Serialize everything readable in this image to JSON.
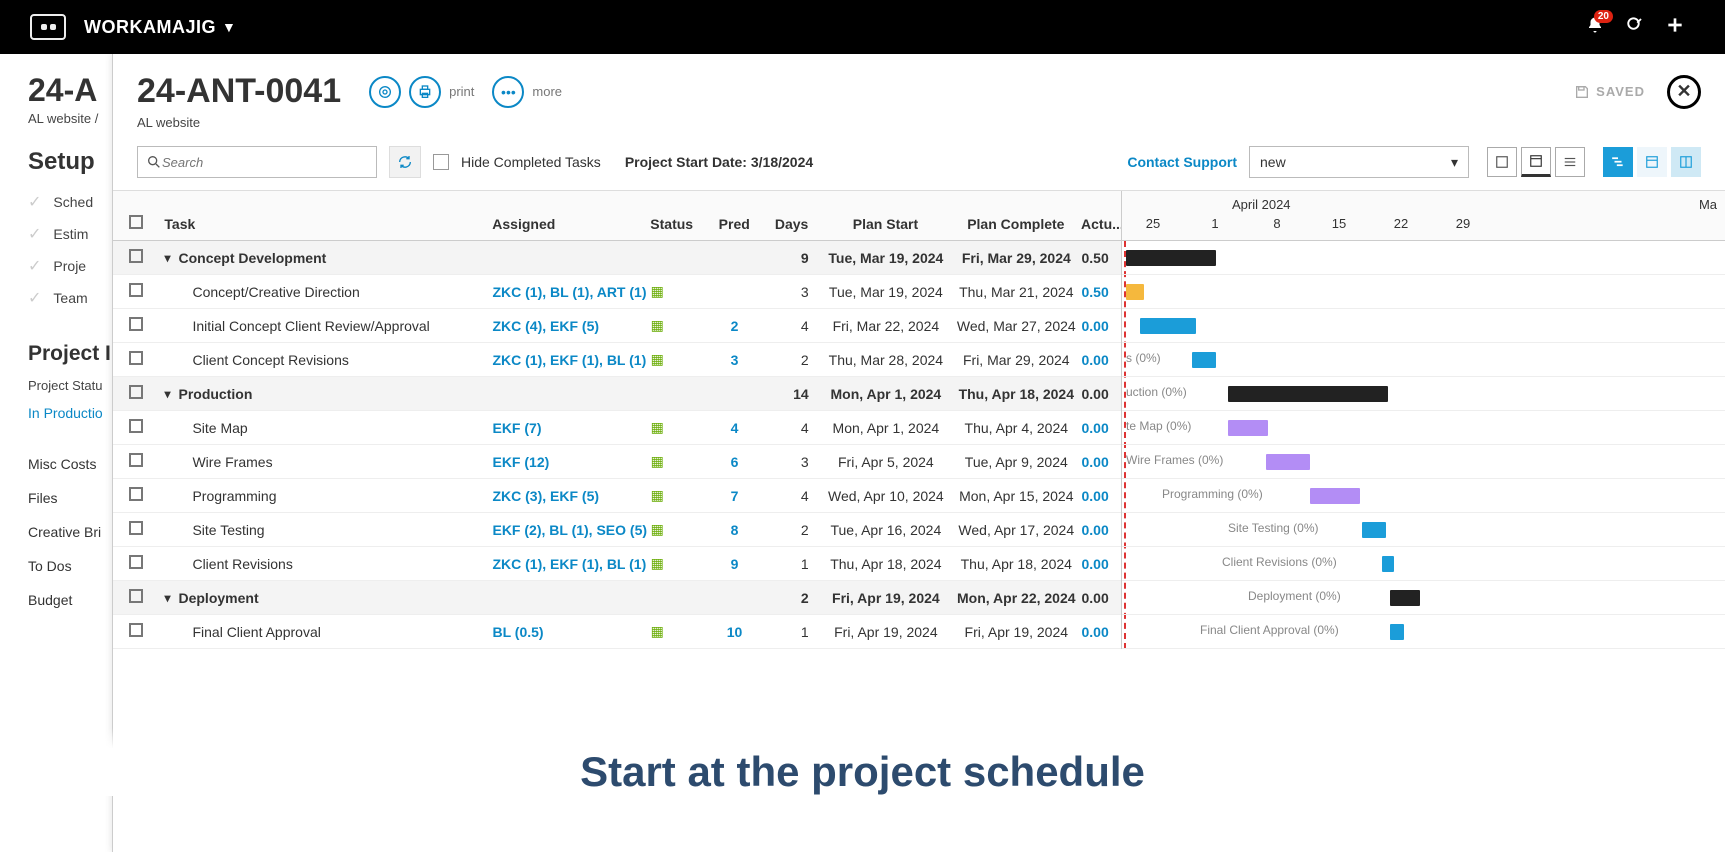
{
  "brand": "WORKAMAJIG",
  "notif_count": "20",
  "left": {
    "title": "24-A",
    "sub": "AL website /",
    "setup": "Setup",
    "setup_items": [
      "Sched",
      "Estim",
      "Proje",
      "Team"
    ],
    "proj_h": "Project I",
    "status_lbl": "Project Statu",
    "status_val": "In Productio",
    "links": [
      "Misc Costs",
      "Files",
      "Creative Bri",
      "To Dos",
      "Budget"
    ]
  },
  "header": {
    "title": "24-ANT-0041",
    "sub": "AL website",
    "print": "print",
    "more": "more",
    "saved": "SAVED"
  },
  "toolbar": {
    "search_ph": "Search",
    "hide": "Hide Completed Tasks",
    "psd_label": "Project Start Date: ",
    "psd_val": "3/18/2024",
    "support": "Contact Support",
    "dd": "new"
  },
  "cols": {
    "task": "Task",
    "assigned": "Assigned",
    "status": "Status",
    "pred": "Pred",
    "days": "Days",
    "ps": "Plan Start",
    "pc": "Plan Complete",
    "act": "Actu..."
  },
  "gantt": {
    "month": "April 2024",
    "month2": "Ma",
    "days": [
      "25",
      "1",
      "8",
      "15",
      "22",
      "29"
    ],
    "labels": {
      "r3": "s (0%)",
      "r4": "uction (0%)",
      "r5": "te Map (0%)",
      "r6": "Wire Frames (0%)",
      "r7": "Programming (0%)",
      "r8": "Site Testing (0%)",
      "r9": "Client Revisions (0%)",
      "r10": "Deployment (0%)",
      "r11": "Final Client Approval (0%)"
    }
  },
  "rows": [
    {
      "g": 1,
      "task": "Concept Development",
      "ass": "",
      "pred": "",
      "days": "9",
      "ps": "Tue, Mar 19, 2024",
      "pc": "Fri, Mar 29, 2024",
      "act": "0.50",
      "aL": 0
    },
    {
      "g": 0,
      "task": "Concept/Creative Direction",
      "ass": "ZKC (1), BL (1), ART (1)",
      "pred": "",
      "cal": 1,
      "days": "3",
      "ps": "Tue, Mar 19, 2024",
      "pc": "Thu, Mar 21, 2024",
      "act": "0.50",
      "aL": 1
    },
    {
      "g": 0,
      "task": "Initial Concept Client Review/Approval",
      "ass": "ZKC (4), EKF (5)",
      "pred": "2",
      "cal": 1,
      "days": "4",
      "ps": "Fri, Mar 22, 2024",
      "pc": "Wed, Mar 27, 2024",
      "act": "0.00",
      "aL": 1
    },
    {
      "g": 0,
      "task": "Client Concept Revisions",
      "ass": "ZKC (1), EKF (1), BL (1)",
      "pred": "3",
      "cal": 1,
      "days": "2",
      "ps": "Thu, Mar 28, 2024",
      "pc": "Fri, Mar 29, 2024",
      "act": "0.00",
      "aL": 1
    },
    {
      "g": 1,
      "task": "Production",
      "ass": "",
      "pred": "",
      "days": "14",
      "ps": "Mon, Apr 1, 2024",
      "pc": "Thu, Apr 18, 2024",
      "act": "0.00",
      "aL": 0
    },
    {
      "g": 0,
      "task": "Site Map",
      "ass": "EKF (7)",
      "pred": "4",
      "cal": 1,
      "days": "4",
      "ps": "Mon, Apr 1, 2024",
      "pc": "Thu, Apr 4, 2024",
      "act": "0.00",
      "aL": 1
    },
    {
      "g": 0,
      "task": "Wire Frames",
      "ass": "EKF (12)",
      "pred": "6",
      "cal": 1,
      "days": "3",
      "ps": "Fri, Apr 5, 2024",
      "pc": "Tue, Apr 9, 2024",
      "act": "0.00",
      "aL": 1
    },
    {
      "g": 0,
      "task": "Programming",
      "ass": "ZKC (3), EKF (5)",
      "pred": "7",
      "cal": 1,
      "days": "4",
      "ps": "Wed, Apr 10, 2024",
      "pc": "Mon, Apr 15, 2024",
      "act": "0.00",
      "aL": 1
    },
    {
      "g": 0,
      "task": "Site Testing",
      "ass": "EKF (2), BL (1), SEO (5)",
      "pred": "8",
      "cal": 1,
      "days": "2",
      "ps": "Tue, Apr 16, 2024",
      "pc": "Wed, Apr 17, 2024",
      "act": "0.00",
      "aL": 1
    },
    {
      "g": 0,
      "task": "Client Revisions",
      "ass": "ZKC (1), EKF (1), BL (1)",
      "pred": "9",
      "cal": 1,
      "days": "1",
      "ps": "Thu, Apr 18, 2024",
      "pc": "Thu, Apr 18, 2024",
      "act": "0.00",
      "aL": 1
    },
    {
      "g": 1,
      "task": "Deployment",
      "ass": "",
      "pred": "",
      "days": "2",
      "ps": "Fri, Apr 19, 2024",
      "pc": "Mon, Apr 22, 2024",
      "act": "0.00",
      "aL": 0
    },
    {
      "g": 0,
      "task": "Final Client Approval",
      "ass": "BL (0.5)",
      "pred": "10",
      "cal": 1,
      "days": "1",
      "ps": "Fri, Apr 19, 2024",
      "pc": "Fri, Apr 19, 2024",
      "act": "0.00",
      "aL": 1
    }
  ],
  "caption": "Start at the project schedule"
}
